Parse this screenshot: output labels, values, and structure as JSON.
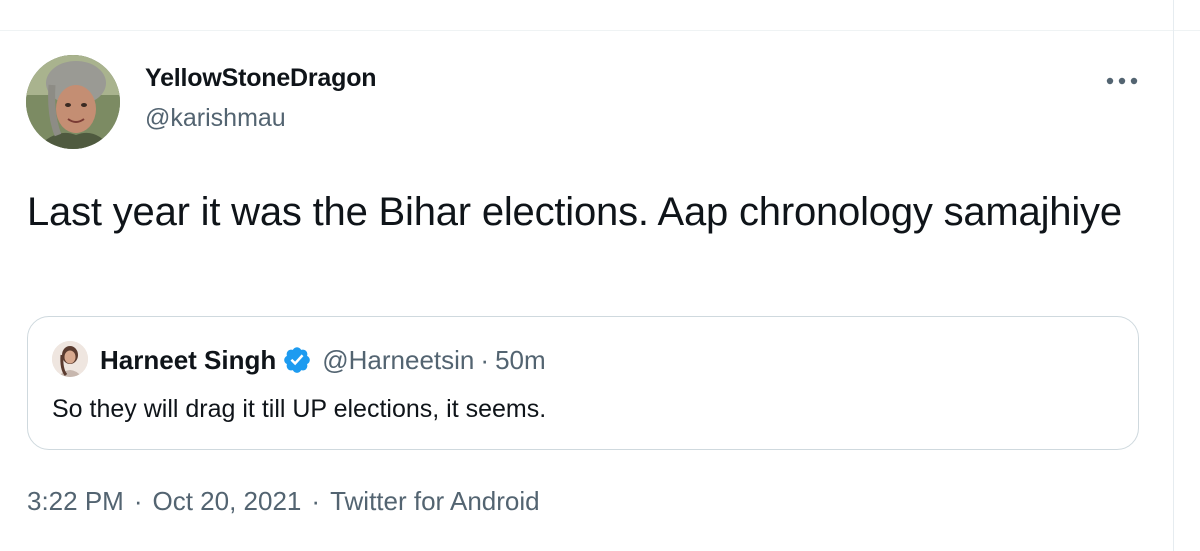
{
  "tweet": {
    "author": {
      "name": "YellowStoneDragon",
      "handle": "@karishmau"
    },
    "text": "Last year it was the Bihar elections. Aap chronology samajhiye",
    "more_icon": "more-horizontal-icon",
    "quoted": {
      "name": "Harneet Singh",
      "verified_icon": "verified-badge-icon",
      "handle": "@Harneetsin",
      "separator": "·",
      "time": "50m",
      "text": "So they will drag it till UP elections, it seems."
    },
    "meta": {
      "time": "3:22 PM",
      "separator1": "·",
      "date": "Oct 20, 2021",
      "separator2": "·",
      "source": "Twitter for Android"
    }
  },
  "colors": {
    "text_primary": "#0f1419",
    "text_secondary": "#536471",
    "border": "#cfd9de",
    "verified_blue": "#1d9bf0"
  }
}
